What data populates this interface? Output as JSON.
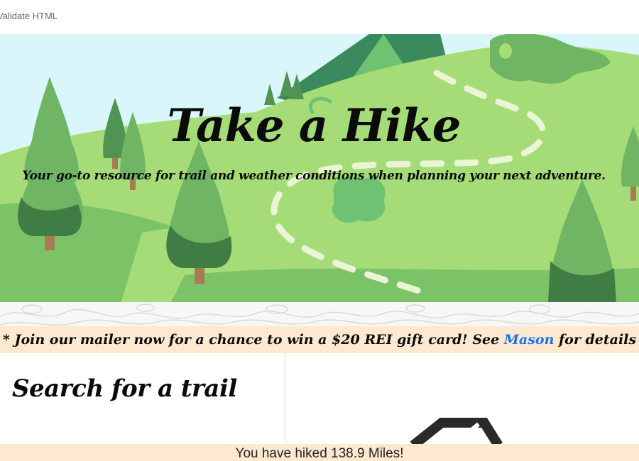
{
  "topbar": {
    "link_label": "Validate HTML"
  },
  "hero": {
    "title": "Take a Hike",
    "subtitle": "Your go-to resource for trail and weather conditions when planning your next adventure."
  },
  "banner": {
    "prefix": "* Join our mailer now for a chance to win a $20 REI gift card! See ",
    "link_text": "Mason",
    "suffix": " for details *"
  },
  "search": {
    "title": "Search for a trail"
  },
  "footer": {
    "miles_text": "You have hiked 138.9 Miles!"
  },
  "colors": {
    "sky": "#d9f7fb",
    "light_hill": "#a6dc77",
    "mid_hill": "#7cc266",
    "tree_light": "#6fb563",
    "tree_dark": "#3f7d45",
    "trunk": "#a87a55",
    "mountain": "#3a8a5d",
    "banner_bg": "#fde9d0",
    "link": "#1a73e8"
  }
}
